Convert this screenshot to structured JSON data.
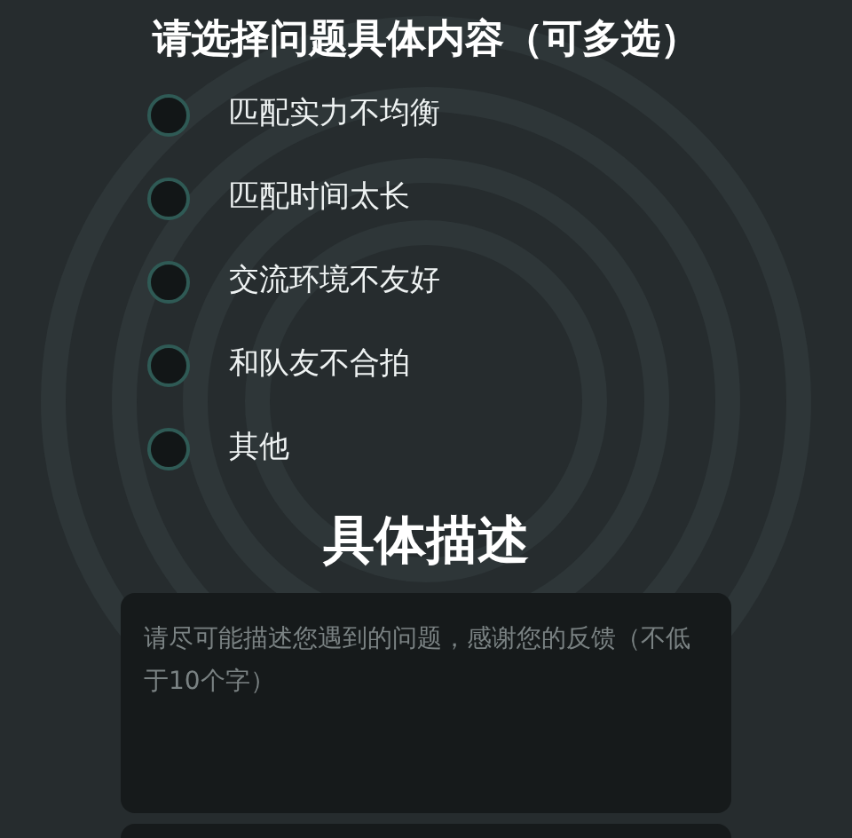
{
  "title": "请选择问题具体内容（可多选）",
  "options": [
    {
      "label": "匹配实力不均衡",
      "checked": false
    },
    {
      "label": "匹配时间太长",
      "checked": false
    },
    {
      "label": "交流环境不友好",
      "checked": false
    },
    {
      "label": "和队友不合拍",
      "checked": false
    },
    {
      "label": "其他",
      "checked": false
    }
  ],
  "description": {
    "title": "具体描述",
    "placeholder": "请尽可能描述您遇到的问题，感谢您的反馈（不低于10个字）"
  }
}
